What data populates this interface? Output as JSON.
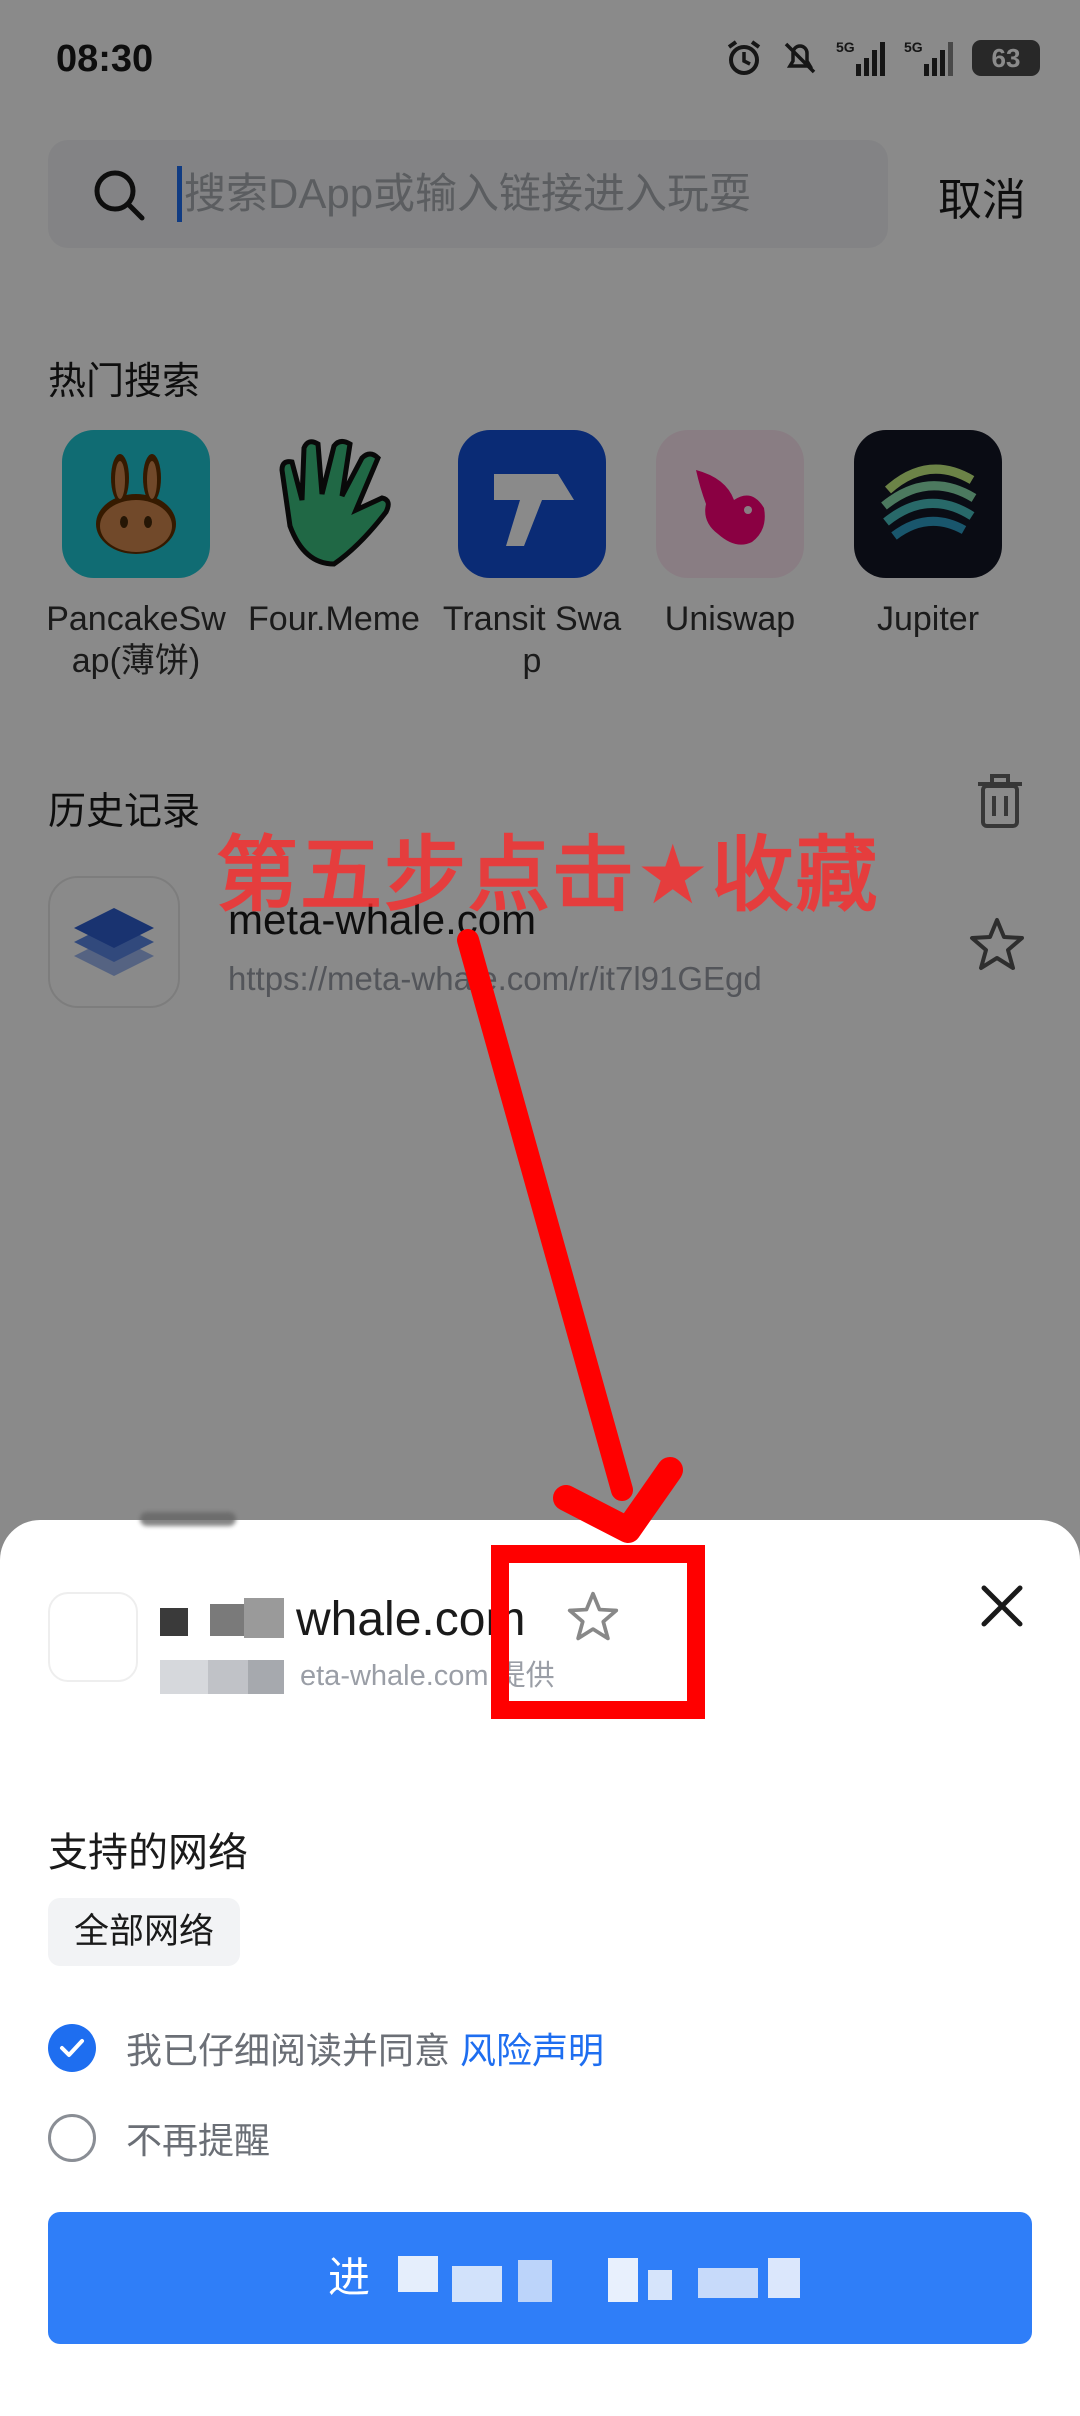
{
  "status_bar": {
    "time": "08:30",
    "battery": "63"
  },
  "search": {
    "placeholder": "搜索DApp或输入链接进入玩耍",
    "cancel_label": "取消"
  },
  "hot": {
    "title": "热门搜索",
    "apps": [
      {
        "name": "PancakeSwap(薄饼)",
        "icon": "pancakeswap-icon"
      },
      {
        "name": "Four.Meme",
        "icon": "fourmeme-icon"
      },
      {
        "name": "Transit Swap",
        "icon": "transitswap-icon"
      },
      {
        "name": "Uniswap",
        "icon": "uniswap-icon"
      },
      {
        "name": "Jupiter",
        "icon": "jupiter-icon"
      }
    ]
  },
  "history": {
    "title": "历史记录",
    "items": [
      {
        "name": "meta-whale.com",
        "url": "https://meta-whale.com/r/it7l91GEgd"
      }
    ]
  },
  "annotation": {
    "text": "第五步点击★收藏"
  },
  "sheet": {
    "title_visible": "whale.com",
    "provider_visible": "eta-whale.com 提供",
    "networks_title": "支持的网络",
    "network_chip": "全部网络",
    "agree_text": "我已仔细阅读并同意",
    "risk_link": "风险声明",
    "remind_text": "不再提醒",
    "enter_visible": "进"
  },
  "colors": {
    "accent": "#1e6ef0",
    "button": "#2f7ef8",
    "annotation": "#ff0000"
  }
}
